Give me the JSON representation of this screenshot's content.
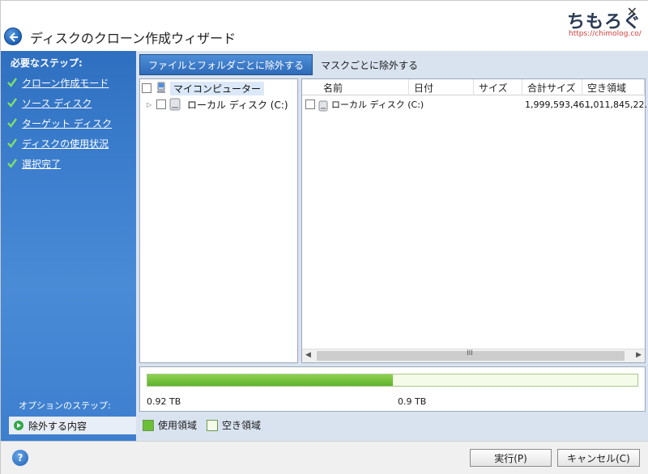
{
  "window": {
    "title": "ディスクのクローン作成ウィザード",
    "close_glyph": "✕",
    "watermark_text": "ちもろぐ",
    "watermark_url": "https://chimolog.co/"
  },
  "sidebar": {
    "required_title": "必要なステップ:",
    "steps": [
      {
        "label": "クローン作成モード"
      },
      {
        "label": "ソース ディスク"
      },
      {
        "label": "ターゲット ディスク"
      },
      {
        "label": "ディスクの使用状況"
      },
      {
        "label": "選択完了"
      }
    ],
    "optional_title": "オプションのステップ:",
    "optional_current": "除外する内容"
  },
  "tabs": [
    {
      "label": "ファイルとフォルダごとに除外する",
      "active": true
    },
    {
      "label": "マスクごとに除外する",
      "active": false
    }
  ],
  "tree": {
    "root": "マイコンピューター",
    "child": "ローカル ディスク (C:)"
  },
  "list": {
    "columns": [
      "名前",
      "日付",
      "サイズ",
      "合計サイズ",
      "空き領域"
    ],
    "rows": [
      {
        "name": "ローカル ディスク (C:)",
        "date": "",
        "size": "",
        "total": "1,999,593,46...",
        "free": "1,011,845,22..."
      }
    ],
    "scroll_grip": "III"
  },
  "disk": {
    "used_fraction": 0.5,
    "used_label": "0.92 TB",
    "total_label": "0.9 TB"
  },
  "legend": {
    "used": "使用領域",
    "free": "空き領域"
  },
  "buttons": {
    "help": "?",
    "run": "実行(P)",
    "cancel": "キャンセル(C)"
  },
  "colors": {
    "sidebar": "#3a7ccc",
    "used": "#6cbf36",
    "free": "#f4fbe9"
  }
}
